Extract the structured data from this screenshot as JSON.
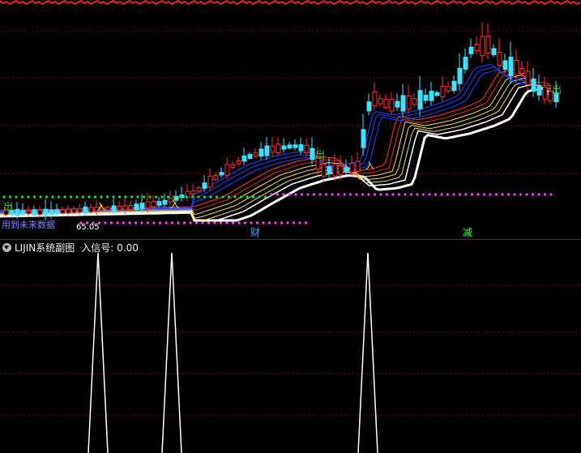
{
  "main_chart": {
    "top_banner_color": "#ff2020",
    "labels": {
      "chu_left": "出",
      "chu_mid": "出",
      "chu_right": "出",
      "ru_1": "入",
      "ru_2": "入",
      "ru_3": "入",
      "cai": "财",
      "jian": "减",
      "bottom_text": "用到未来数据",
      "low_price": "65.05"
    },
    "colors": {
      "up_candle": "#ff3030",
      "down_candle": "#40e0ff",
      "green_dots": "#22dd22",
      "magenta_dots": "#ff40ff",
      "ma_white": "#ffffff",
      "ma_yellow": "#f0e060",
      "ma_red": "#e03020",
      "ma_blue": "#2040ff"
    }
  },
  "sub_chart": {
    "title": "LIJIN系统副图",
    "signal_label": "入信号: 0.00",
    "icon": "chevron-down-icon",
    "spike_color": "#ffffff",
    "grid_color": "#8a0000"
  }
}
